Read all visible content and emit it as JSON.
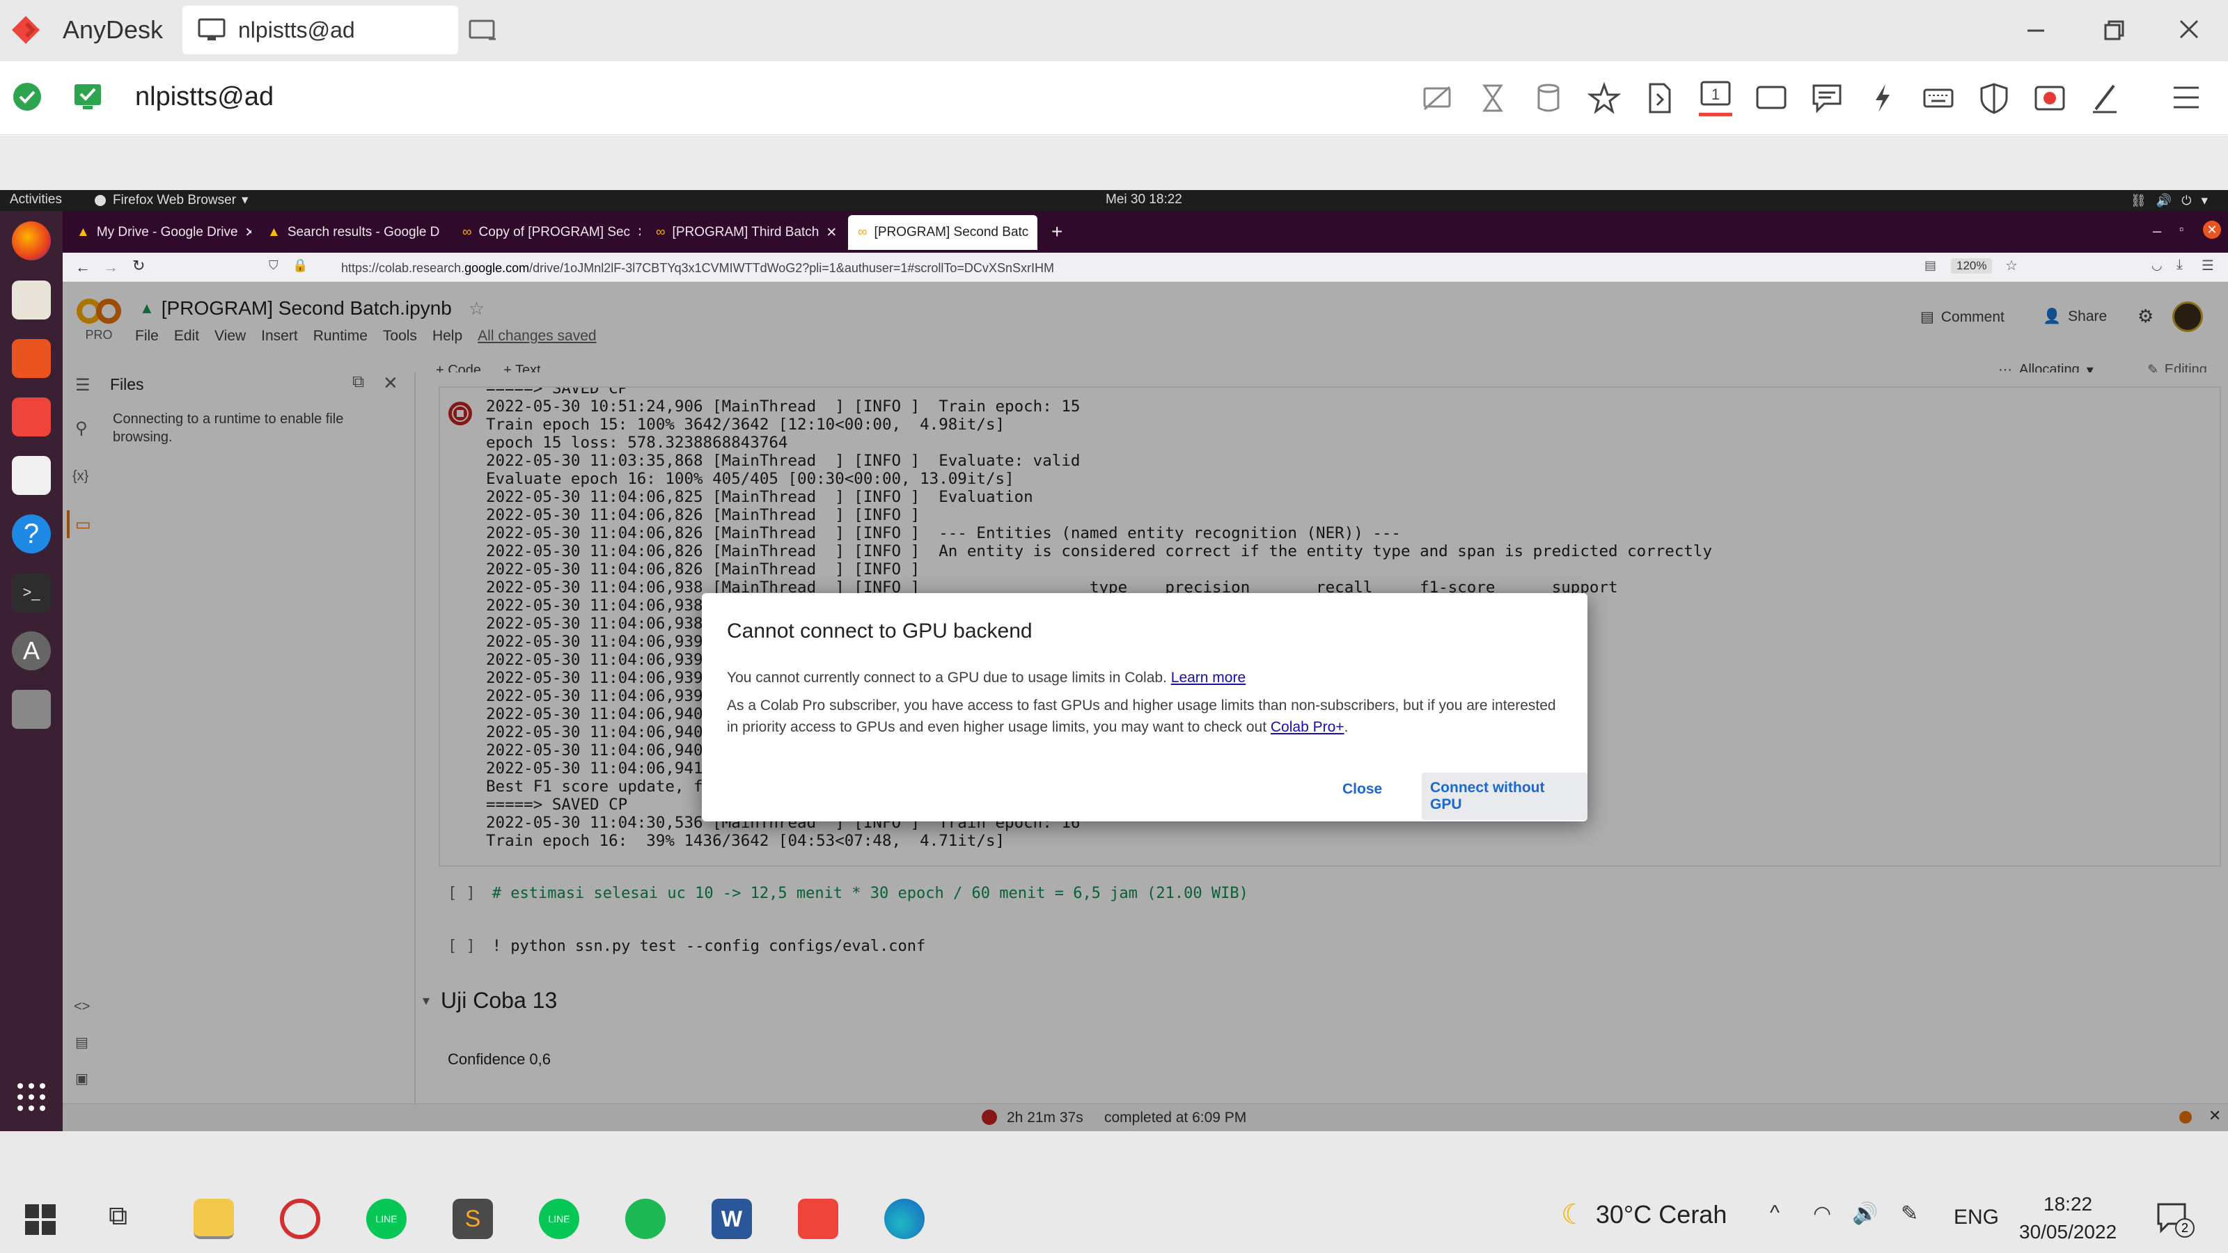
{
  "anydesk": {
    "app_name": "AnyDesk",
    "tab_label": "nlpistts@ad",
    "toolbar_address": "nlpistts@ad",
    "monitor_number": "1"
  },
  "ubuntu": {
    "activities": "Activities",
    "app_menu": "Firefox Web Browser",
    "clock": "Mei 30  18:22"
  },
  "firefox": {
    "tabs": [
      {
        "label": "My Drive - Google Drive"
      },
      {
        "label": "Search results - Google D"
      },
      {
        "label": "Copy of [PROGRAM] Sec"
      },
      {
        "label": "[PROGRAM] Third Batch"
      },
      {
        "label": "[PROGRAM] Second Batc"
      }
    ],
    "url_prefix": "https://colab.research.",
    "url_domain": "google.com",
    "url_rest": "/drive/1oJMnl2lF-3l7CBTYq3x1CVMIWTTdWoG2?pli=1&authuser=1#scrollTo=DCvXSnSxrIHM",
    "zoom": "120%"
  },
  "colab": {
    "notebook_title": "[PROGRAM] Second Batch.ipynb",
    "pro_label": "PRO",
    "menu": [
      "File",
      "Edit",
      "View",
      "Insert",
      "Runtime",
      "Tools",
      "Help"
    ],
    "saved_status": "All changes saved",
    "comment": "Comment",
    "share": "Share",
    "add_code": "+ Code",
    "add_text": "+ Text",
    "runtime_status": "Allocating",
    "editing": "Editing",
    "files_title": "Files",
    "files_message": "Connecting to a runtime to enable file browsing.",
    "variables_icon_text": "{x}",
    "output_lines": [
      "=====> SAVED CP",
      "2022-05-30 10:51:24,906 [MainThread  ] [INFO ]  Train epoch: 15",
      "Train epoch 15: 100% 3642/3642 [12:10<00:00,  4.98it/s]",
      "epoch 15 loss: 578.3238868843764",
      "2022-05-30 11:03:35,868 [MainThread  ] [INFO ]  Evaluate: valid",
      "Evaluate epoch 16: 100% 405/405 [00:30<00:00, 13.09it/s]",
      "2022-05-30 11:04:06,825 [MainThread  ] [INFO ]  Evaluation",
      "2022-05-30 11:04:06,826 [MainThread  ] [INFO ]",
      "2022-05-30 11:04:06,826 [MainThread  ] [INFO ]  --- Entities (named entity recognition (NER)) ---",
      "2022-05-30 11:04:06,826 [MainThread  ] [INFO ]  An entity is considered correct if the entity type and span is predicted correctly",
      "2022-05-30 11:04:06,826 [MainThread  ] [INFO ]",
      "2022-05-30 11:04:06,938 [MainThread  ] [INFO ]                  type    precision       recall     f1-score      support",
      "2022-05-30 11:04:06,938",
      "2022-05-30 11:04:06,938",
      "2022-05-30 11:04:06,939",
      "2022-05-30 11:04:06,939",
      "2022-05-30 11:04:06,939",
      "2022-05-30 11:04:06,939",
      "2022-05-30 11:04:06,940",
      "2022-05-30 11:04:06,940",
      "2022-05-30 11:04:06,940",
      "2022-05-30 11:04:06,941",
      "Best F1 score update, fr",
      "=====> SAVED CP",
      "2022-05-30 11:04:30,536 [MainThread  ] [INFO ]  Train epoch: 16",
      "Train epoch 16:  39% 1436/3642 [04:53<07:48,  4.71it/s]"
    ],
    "cell2_bracket": "[ ]",
    "cell2_code": "# estimasi selesai uc 10 -> 12,5 menit * 30 epoch / 60 menit = 6,5 jam (21.00 WIB)",
    "cell3_bracket": "[ ]",
    "cell3_code": "! python ssn.py test --config configs/eval.conf",
    "section_title": "Uji Coba 13",
    "section_text": "Confidence 0,6",
    "status_elapsed": "2h 21m 37s",
    "status_completed": "completed at 6:09 PM"
  },
  "dialog": {
    "title": "Cannot connect to GPU backend",
    "line1": "You cannot currently connect to a GPU due to usage limits in Colab.",
    "learn_more": "Learn more",
    "line2": "As a Colab Pro subscriber, you have access to fast GPUs and higher usage limits than non-subscribers, but if you are interested",
    "line3": "in priority access to GPUs and even higher usage limits, you may want to check out",
    "colab_pro_plus": "Colab Pro+",
    "line3_end": ".",
    "close": "Close",
    "connect_without_gpu": "Connect without GPU"
  },
  "taskbar": {
    "weather": "30°C  Cerah",
    "language": "ENG",
    "time": "18:22",
    "date": "30/05/2022",
    "notification_count": "2"
  },
  "colors": {
    "anydesk_red": "#ef443b",
    "colab_orange": "#f9ab00",
    "firefox_tabbar": "#2f0a2a",
    "dock": "#3b1f33",
    "link_blue": "#1a0dab",
    "button_blue": "#1967d2"
  }
}
